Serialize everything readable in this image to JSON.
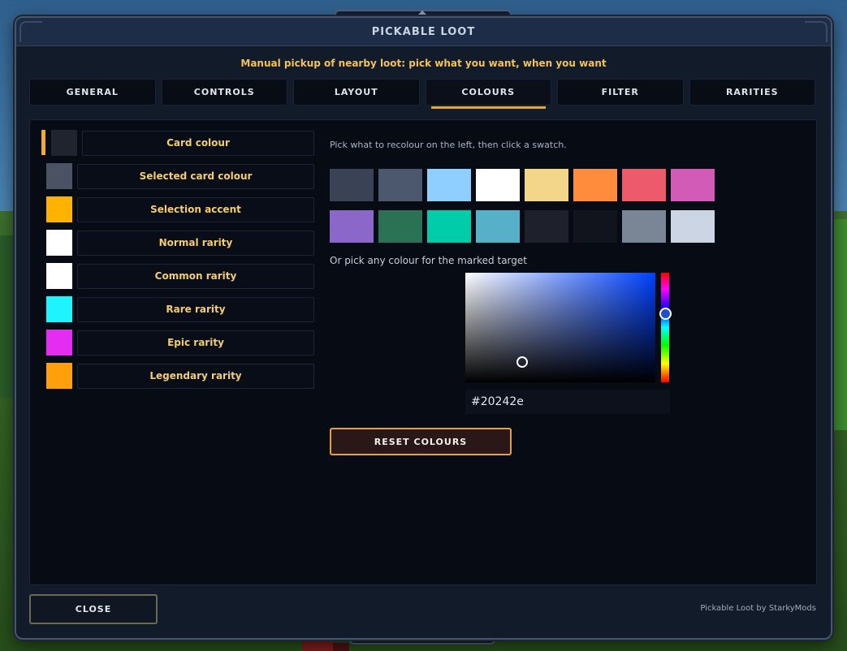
{
  "window": {
    "title": "PICKABLE LOOT",
    "subtitle": "Manual pickup of nearby loot: pick what you want, when you want"
  },
  "tabs": [
    {
      "label": "GENERAL",
      "active": false
    },
    {
      "label": "CONTROLS",
      "active": false
    },
    {
      "label": "LAYOUT",
      "active": false
    },
    {
      "label": "COLOURS",
      "active": true
    },
    {
      "label": "FILTER",
      "active": false
    },
    {
      "label": "RARITIES",
      "active": false
    }
  ],
  "targets": [
    {
      "label": "Card colour",
      "color": "#20242e",
      "active": true
    },
    {
      "label": "Selected card colour",
      "color": "#4a5263",
      "active": false
    },
    {
      "label": "Selection accent",
      "color": "#ffb300",
      "active": false
    },
    {
      "label": "Normal rarity",
      "color": "#ffffff",
      "active": false
    },
    {
      "label": "Common rarity",
      "color": "#ffffff",
      "active": false
    },
    {
      "label": "Rare rarity",
      "color": "#1ef4ff",
      "active": false
    },
    {
      "label": "Epic rarity",
      "color": "#e42cf2",
      "active": false
    },
    {
      "label": "Legendary rarity",
      "color": "#ff9f0a",
      "active": false
    }
  ],
  "colour_panel": {
    "hint": "Pick what to recolour on the left, then click a swatch.",
    "palette": [
      "#3a4355",
      "#4b586e",
      "#8ecfff",
      "#ffffff",
      "#f3d68a",
      "#ff8b3d",
      "#ec5a6c",
      "#d25bb7",
      "#8a67c8",
      "#2b7154",
      "#00ccaa",
      "#55b0c8",
      "#1e212b",
      "#11141c",
      "#7a8696",
      "#cbd5e3"
    ],
    "picker_label": "Or pick any colour for the marked target",
    "hex_value": "#20242e",
    "reset_label": "RESET COLOURS"
  },
  "footer": {
    "close_label": "CLOSE",
    "credit": "Pickable Loot by StarkyMods"
  }
}
